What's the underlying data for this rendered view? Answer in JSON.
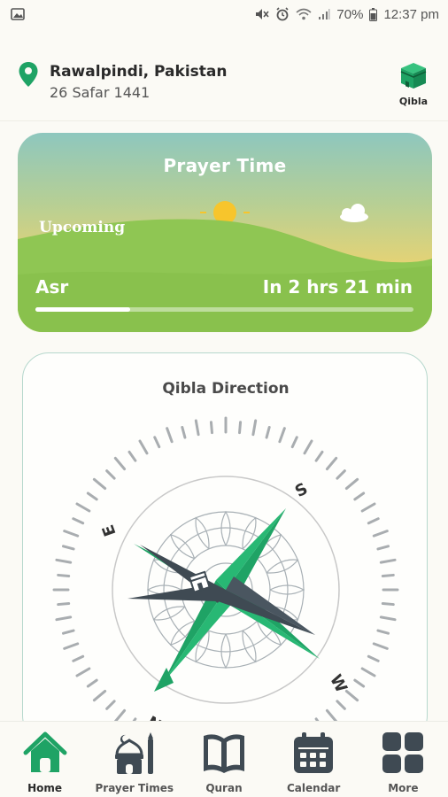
{
  "status_bar": {
    "battery": "70%",
    "time": "12:37 pm",
    "icons": [
      "image-icon",
      "mute-icon",
      "alarm-icon",
      "wifi-icon",
      "signal-icon",
      "battery-icon"
    ]
  },
  "header": {
    "location": "Rawalpindi, Pakistan",
    "hijri_date": "26 Safar 1441",
    "qibla_label": "Qibla"
  },
  "prayer_card": {
    "title": "Prayer Time",
    "upcoming_label": "Upcoming",
    "prayer_name": "Asr",
    "time_remaining": "In 2 hrs 21 min",
    "progress": 0.25
  },
  "qibla_card": {
    "title": "Qibla Direction",
    "directions": {
      "south": "S",
      "east": "E",
      "west": "W",
      "north": "N"
    }
  },
  "bottom_nav": {
    "items": [
      {
        "label": "Home",
        "icon": "home-icon",
        "active": true
      },
      {
        "label": "Prayer Times",
        "icon": "mosque-icon",
        "active": false
      },
      {
        "label": "Quran",
        "icon": "book-icon",
        "active": false
      },
      {
        "label": "Calendar",
        "icon": "calendar-icon",
        "active": false
      },
      {
        "label": "More",
        "icon": "grid-icon",
        "active": false
      }
    ]
  },
  "colors": {
    "accent_green": "#1fa365",
    "dark_needle": "#3f4a53",
    "hill_green": "#8fc653",
    "sun": "#f7c52c"
  }
}
